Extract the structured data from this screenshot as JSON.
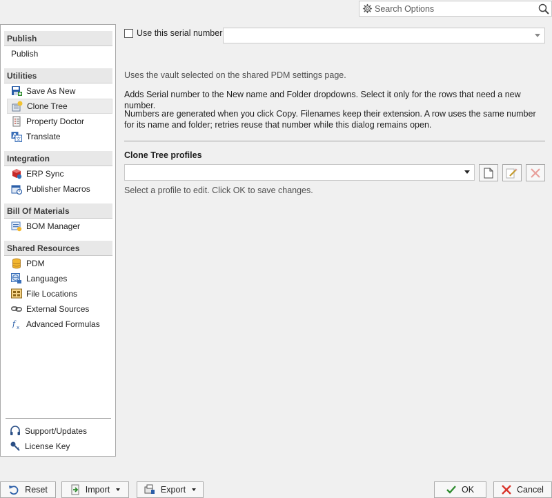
{
  "search": {
    "placeholder": "Search Options"
  },
  "sidebar": {
    "sections": [
      {
        "title": "Publish",
        "items": [
          {
            "label": "Publish",
            "icon": "none"
          }
        ]
      },
      {
        "title": "Utilities",
        "items": [
          {
            "label": "Save As New",
            "icon": "save-as-icon"
          },
          {
            "label": "Clone Tree",
            "icon": "clone-tree-icon",
            "selected": true
          },
          {
            "label": "Property Doctor",
            "icon": "property-doctor-icon"
          },
          {
            "label": "Translate",
            "icon": "translate-icon"
          }
        ]
      },
      {
        "title": "Integration",
        "items": [
          {
            "label": "ERP Sync",
            "icon": "erp-sync-icon"
          },
          {
            "label": "Publisher Macros",
            "icon": "macros-icon"
          }
        ]
      },
      {
        "title": "Bill Of Materials",
        "items": [
          {
            "label": "BOM Manager",
            "icon": "bom-manager-icon"
          }
        ]
      },
      {
        "title": "Shared Resources",
        "items": [
          {
            "label": "PDM",
            "icon": "database-icon"
          },
          {
            "label": "Languages",
            "icon": "globe-icon"
          },
          {
            "label": "File Locations",
            "icon": "file-locations-icon"
          },
          {
            "label": "External Sources",
            "icon": "link-icon"
          },
          {
            "label": "Advanced Formulas",
            "icon": "function-icon"
          }
        ]
      }
    ],
    "footer": [
      {
        "label": "Support/Updates",
        "icon": "headset-icon"
      },
      {
        "label": "License Key",
        "icon": "key-icon"
      }
    ]
  },
  "main": {
    "serial_checkbox_label": "Use this serial number",
    "serial_checked": false,
    "para1": "Uses the vault selected on the shared PDM settings page.",
    "para2": "Adds Serial number to the New name and Folder dropdowns. Select it only for the rows that need a new number.",
    "para3": "Numbers are generated when you click Copy. Filenames keep their extension. A row uses the same number for its name and folder; retries reuse that number while this dialog remains open.",
    "profiles_label": "Clone Tree profiles",
    "profile_hint": "Select a profile to edit. Click OK to save changes."
  },
  "footer_buttons": {
    "reset": "Reset",
    "import": "Import",
    "export": "Export",
    "ok": "OK",
    "cancel": "Cancel"
  },
  "colors": {
    "accent_red": "#d9342b",
    "ok_green": "#2e8b2e"
  }
}
